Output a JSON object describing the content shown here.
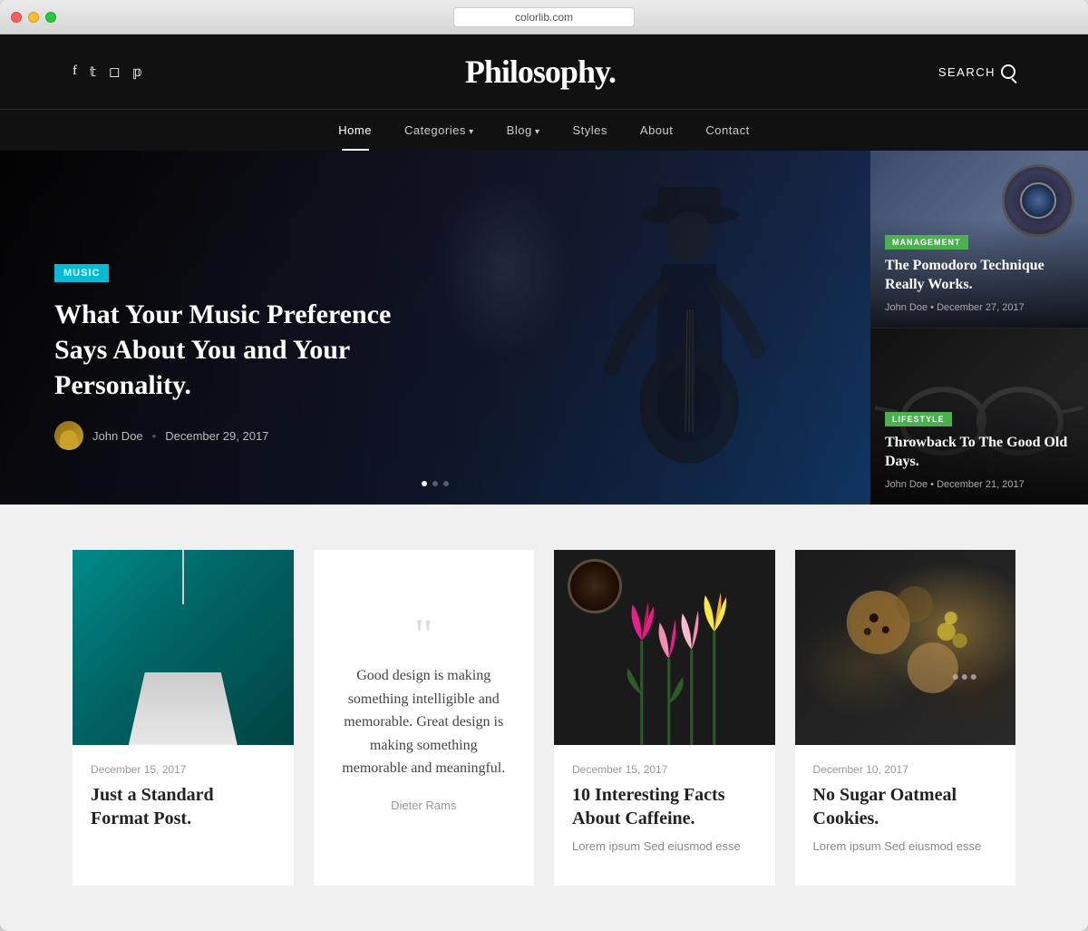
{
  "browser": {
    "url": "colorlib.com"
  },
  "header": {
    "logo": "Philosophy.",
    "search_label": "SEARCH",
    "social_icons": [
      "f",
      "t",
      "i",
      "p"
    ]
  },
  "nav": {
    "items": [
      {
        "label": "Home",
        "active": true,
        "dropdown": false
      },
      {
        "label": "Categories",
        "active": false,
        "dropdown": true
      },
      {
        "label": "Blog",
        "active": false,
        "dropdown": true
      },
      {
        "label": "Styles",
        "active": false,
        "dropdown": false
      },
      {
        "label": "About",
        "active": false,
        "dropdown": false
      },
      {
        "label": "Contact",
        "active": false,
        "dropdown": false
      }
    ]
  },
  "hero": {
    "main": {
      "tag": "MUSIC",
      "title": "What Your Music Preference Says About You and Your Personality.",
      "author": "John Doe",
      "date": "December 29, 2017"
    },
    "cards": [
      {
        "tag": "MANAGEMENT",
        "tag_type": "management",
        "title": "The Pomodoro Technique Really Works.",
        "author": "John Doe",
        "date": "December 27, 2017"
      },
      {
        "tag": "LIFESTYLE",
        "tag_type": "lifestyle",
        "title": "Throwback To The Good Old Days.",
        "author": "John Doe",
        "date": "December 21, 2017"
      }
    ]
  },
  "posts": [
    {
      "type": "image",
      "image_type": "lamp",
      "date": "December 15, 2017",
      "title": "Just a Standard Format Post.",
      "excerpt": ""
    },
    {
      "type": "quote",
      "quote_text": "Good design is making something intelligible and memorable. Great design is making something memorable and meaningful.",
      "quote_author": "Dieter Rams"
    },
    {
      "type": "image",
      "image_type": "coffee",
      "date": "December 15, 2017",
      "title": "10 Interesting Facts About Caffeine.",
      "excerpt": "Lorem ipsum Sed eiusmod esse"
    },
    {
      "type": "image",
      "image_type": "food",
      "date": "December 10, 2017",
      "title": "No Sugar Oatmeal Cookies.",
      "excerpt": "Lorem ipsum Sed eiusmod esse"
    }
  ]
}
